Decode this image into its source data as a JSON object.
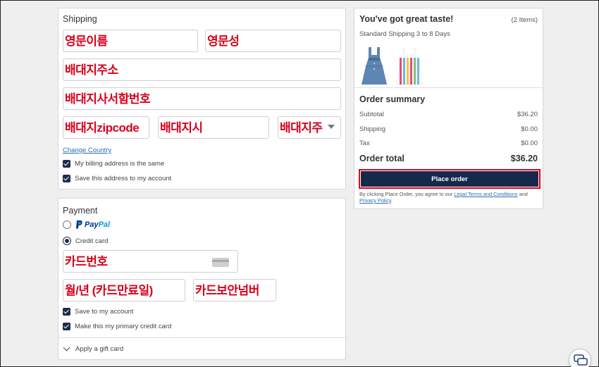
{
  "shipping": {
    "title": "Shipping",
    "first_name_annot": "영문이름",
    "last_name_annot": "영문성",
    "address_annot": "배대지주소",
    "address2_annot": "배대지사서함번호",
    "zip_annot": "배대지zipcode",
    "city_annot": "배대지시",
    "state_annot": "배대지주",
    "change_country": "Change Country",
    "billing_same": "My billing address is the same",
    "save_address": "Save this address to my account"
  },
  "payment": {
    "title": "Payment",
    "paypal_pay": "Pay",
    "paypal_pal": "Pal",
    "credit_card": "Credit card",
    "card_number_annot": "카드번호",
    "expiry_annot": "월/년 (카드만료일)",
    "cvv_annot": "카드보안넘버",
    "save_account": "Save to my account",
    "primary_card": "Make this my primary credit card",
    "gift_card": "Apply a gift card"
  },
  "cart": {
    "title": "You've got great taste!",
    "count": "(2 Items)",
    "shipping_note": "Standard Shipping 3 to 8 Days"
  },
  "summary": {
    "title": "Order summary",
    "subtotal_label": "Subtotal",
    "subtotal_value": "$36.20",
    "shipping_label": "Shipping",
    "shipping_value": "$0.00",
    "tax_label": "Tax",
    "tax_value": "$0.00",
    "total_label": "Order total",
    "total_value": "$36.20",
    "place_order": "Place order",
    "fine_prefix": "By clicking Place Order, you agree to our ",
    "terms_link": "Legal Terms and Conditions",
    "fine_and": " and ",
    "privacy_link": "Privacy Policy",
    "fine_suffix": "."
  },
  "colors": {
    "accent_navy": "#17294a",
    "annotation_red": "#d9001b",
    "link_blue": "#2a6ebb"
  }
}
